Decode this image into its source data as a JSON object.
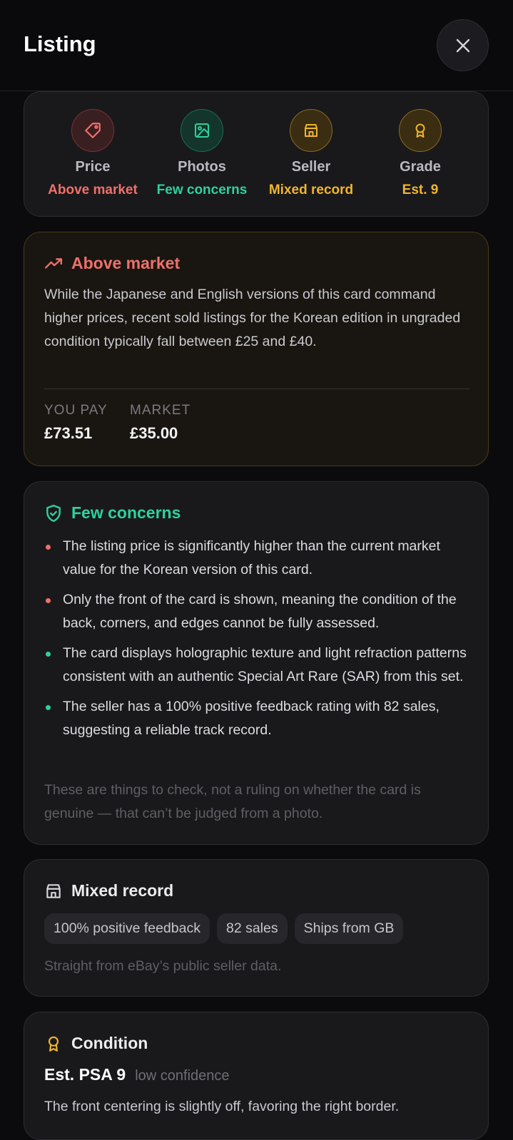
{
  "header": {
    "title": "Listing"
  },
  "summary": [
    {
      "label": "Price",
      "status": "Above market",
      "color": "#f0706a",
      "icon": "tag-icon"
    },
    {
      "label": "Photos",
      "status": "Few concerns",
      "color": "#2fd19a",
      "icon": "image-icon"
    },
    {
      "label": "Seller",
      "status": "Mixed record",
      "color": "#f2b52c",
      "icon": "store-icon"
    },
    {
      "label": "Grade",
      "status": "Est. 9",
      "color": "#f2b52c",
      "icon": "award-icon"
    }
  ],
  "price": {
    "title": "Above market",
    "description": "While the Japanese and English versions of this card command higher prices, recent sold listings for the Korean edition in ungraded condition typically fall between £25 and £40.",
    "you_pay_label": "YOU PAY",
    "you_pay_value": "£73.51",
    "market_label": "MARKET",
    "market_value": "£35.00"
  },
  "photos": {
    "title": "Few concerns",
    "items": [
      {
        "text": "The listing price is significantly higher than the current market value for the Korean version of this card.",
        "kind": "negative"
      },
      {
        "text": "Only the front of the card is shown, meaning the condition of the back, corners, and edges cannot be fully assessed.",
        "kind": "negative"
      },
      {
        "text": "The card displays holographic texture and light refraction patterns consistent with an authentic Special Art Rare (SAR) from this set.",
        "kind": "positive"
      },
      {
        "text": "The seller has a 100% positive feedback rating with 82 sales, suggesting a reliable track record.",
        "kind": "positive"
      }
    ],
    "note": "These are things to check, not a ruling on whether the card is genuine — that can’t be judged from a photo."
  },
  "seller": {
    "title": "Mixed record",
    "chips": [
      "100% positive feedback",
      "82 sales",
      "Ships from GB"
    ],
    "note": "Straight from eBay’s public seller data."
  },
  "condition": {
    "title": "Condition",
    "grade": "Est. PSA 9",
    "confidence": "low confidence",
    "description": "The front centering is slightly off, favoring the right border."
  },
  "colors": {
    "negative": "#f0706a",
    "positive": "#2fd19a",
    "warning": "#f2b52c"
  }
}
